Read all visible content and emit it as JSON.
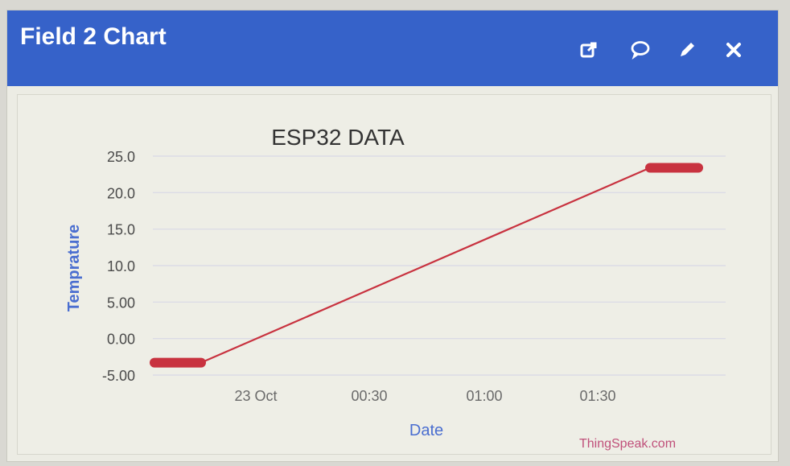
{
  "widget": {
    "title": "Field 2 Chart",
    "icons": [
      "external-link-icon",
      "comment-icon",
      "pencil-icon",
      "close-icon"
    ]
  },
  "chart_data": {
    "type": "line",
    "title": "ESP32 DATA",
    "xlabel": "Date",
    "ylabel": "Temprature",
    "y_ticks": [
      "25.0",
      "20.0",
      "15.0",
      "10.0",
      "5.00",
      "0.00",
      "-5.00"
    ],
    "x_ticks": [
      "23 Oct",
      "00:30",
      "01:00",
      "01:30"
    ],
    "ylim": [
      -5,
      25
    ],
    "grid": true,
    "series": [
      {
        "color": "#c8323f",
        "points": [
          {
            "x": "23 Oct 00:00 (approx, before tick)",
            "y": -3.3
          },
          {
            "x": "approx",
            "y": -3.3
          },
          {
            "x": "approx",
            "y": 23.4
          },
          {
            "x": "approx",
            "y": 23.4
          }
        ]
      }
    ],
    "credit": "ThingSpeak.com"
  },
  "colors": {
    "header": "#3662c9",
    "line": "#c8323f",
    "axis_label": "#4a6ed0",
    "credit": "#c0507a"
  }
}
